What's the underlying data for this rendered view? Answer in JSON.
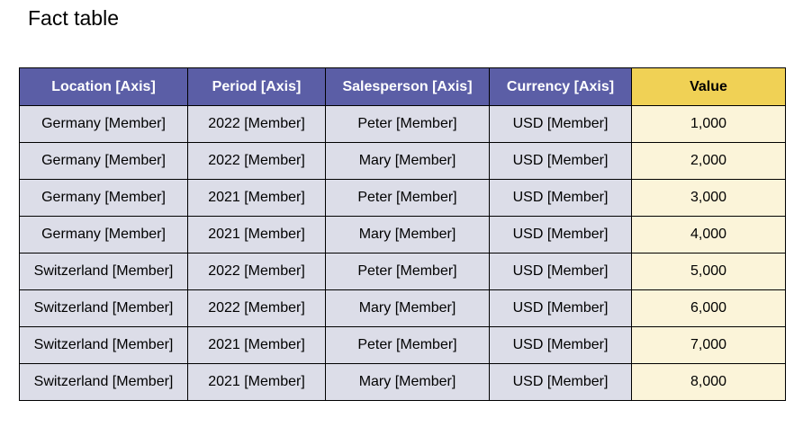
{
  "title": "Fact table",
  "colors": {
    "header_bg": "#5b5ea6",
    "header_text": "#ffffff",
    "value_header_bg": "#f0d155",
    "cell_bg": "#dcdde8",
    "value_cell_bg": "#fbf4d9"
  },
  "table": {
    "headers": [
      "Location [Axis]",
      "Period [Axis]",
      "Salesperson [Axis]",
      "Currency [Axis]",
      "Value"
    ],
    "rows": [
      [
        "Germany [Member]",
        "2022 [Member]",
        "Peter [Member]",
        "USD [Member]",
        "1,000"
      ],
      [
        "Germany [Member]",
        "2022 [Member]",
        "Mary [Member]",
        "USD [Member]",
        "2,000"
      ],
      [
        "Germany [Member]",
        "2021 [Member]",
        "Peter [Member]",
        "USD [Member]",
        "3,000"
      ],
      [
        "Germany [Member]",
        "2021 [Member]",
        "Mary [Member]",
        "USD [Member]",
        "4,000"
      ],
      [
        "Switzerland [Member]",
        "2022 [Member]",
        "Peter [Member]",
        "USD [Member]",
        "5,000"
      ],
      [
        "Switzerland [Member]",
        "2022 [Member]",
        "Mary [Member]",
        "USD [Member]",
        "6,000"
      ],
      [
        "Switzerland [Member]",
        "2021 [Member]",
        "Peter [Member]",
        "USD [Member]",
        "7,000"
      ],
      [
        "Switzerland [Member]",
        "2021 [Member]",
        "Mary [Member]",
        "USD [Member]",
        "8,000"
      ]
    ]
  }
}
